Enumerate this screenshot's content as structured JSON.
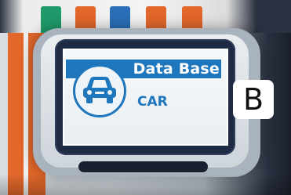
{
  "screen": {
    "title": "Data Base",
    "subtitle": "CAR",
    "header_color": "#1e76bd",
    "icon": "car-icon"
  },
  "label": {
    "text": "B"
  },
  "colors": {
    "orange": "#e2672a",
    "green": "#1f9a6a",
    "blue": "#2a6fb8",
    "bezel": "#1f2a44"
  }
}
